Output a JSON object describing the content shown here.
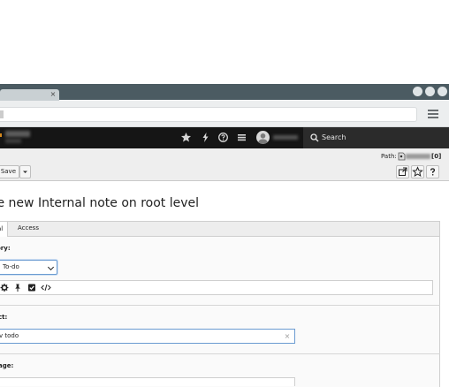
{
  "browser": {
    "tab_close": "×",
    "colors": {
      "titlebar": "#4b5b62",
      "toolbar": "#eceeef"
    }
  },
  "appbar": {
    "icons": [
      "star-icon",
      "bolt-icon",
      "help-icon",
      "list-icon",
      "avatar-icon"
    ],
    "search_label": "Search"
  },
  "docheader": {
    "path_label": "Path:",
    "path_count": "[0]",
    "save_label": "Save"
  },
  "page": {
    "title": "te new Internal note on root level",
    "tabs": [
      {
        "label": "al"
      },
      {
        "label": "Access"
      }
    ]
  },
  "form": {
    "category_label": "ory:",
    "category_value": "To-do",
    "subject_label": "ct:",
    "subject_value": "v todo",
    "message_label": "age:",
    "clear_icon": "×"
  }
}
